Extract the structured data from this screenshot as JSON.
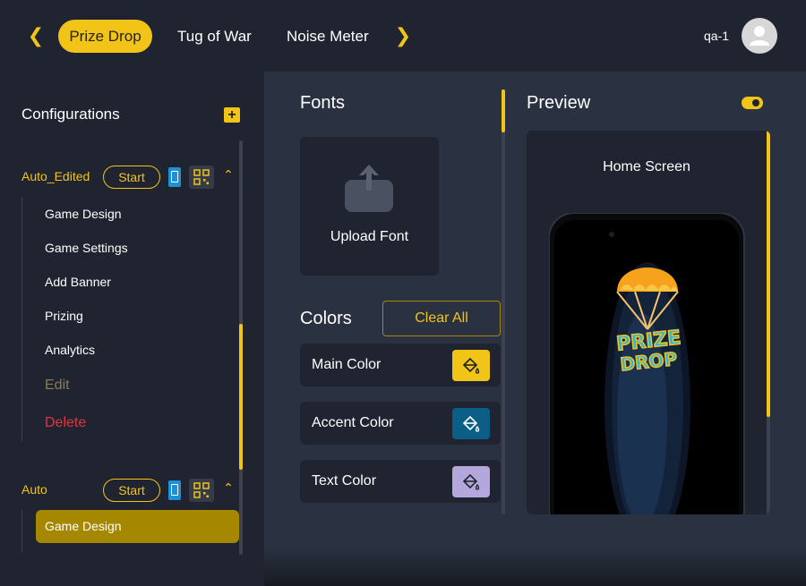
{
  "topbar": {
    "tabs": [
      {
        "label": "Prize Drop",
        "active": true
      },
      {
        "label": "Tug of War",
        "active": false
      },
      {
        "label": "Noise Meter",
        "active": false
      }
    ],
    "prev_icon": "chevron-left-icon",
    "next_icon": "chevron-right-icon",
    "username": "qa-1",
    "avatar_icon": "user-icon"
  },
  "sidebar": {
    "title": "Configurations",
    "add_icon": "plus-icon",
    "configs": [
      {
        "name": "Auto_Edited",
        "start_label": "Start",
        "expanded": true,
        "items": [
          "Game Design",
          "Game Settings",
          "Add Banner",
          "Prizing",
          "Analytics"
        ],
        "edit_label": "Edit",
        "delete_label": "Delete"
      },
      {
        "name": "Auto",
        "start_label": "Start",
        "expanded": true,
        "items": [
          "Game Design"
        ],
        "selected_item": "Game Design"
      }
    ]
  },
  "fonts": {
    "title": "Fonts",
    "upload_label": "Upload Font",
    "upload_icon": "upload-icon"
  },
  "colors": {
    "title": "Colors",
    "clear_label": "Clear All",
    "items": [
      {
        "label": "Main Color",
        "value": "#f2c418"
      },
      {
        "label": "Accent Color",
        "value": "#0b5f86"
      },
      {
        "label": "Text Color",
        "value": "#b4a7dc"
      }
    ]
  },
  "preview": {
    "title": "Preview",
    "toggle_on": true,
    "screen_label": "Home Screen",
    "logo_text_top": "PRIZE",
    "logo_text_bottom": "DROP"
  },
  "theme": {
    "accent": "#f2c418",
    "background": "#1f2430",
    "panel": "#2a3140",
    "danger": "#e4343f"
  }
}
